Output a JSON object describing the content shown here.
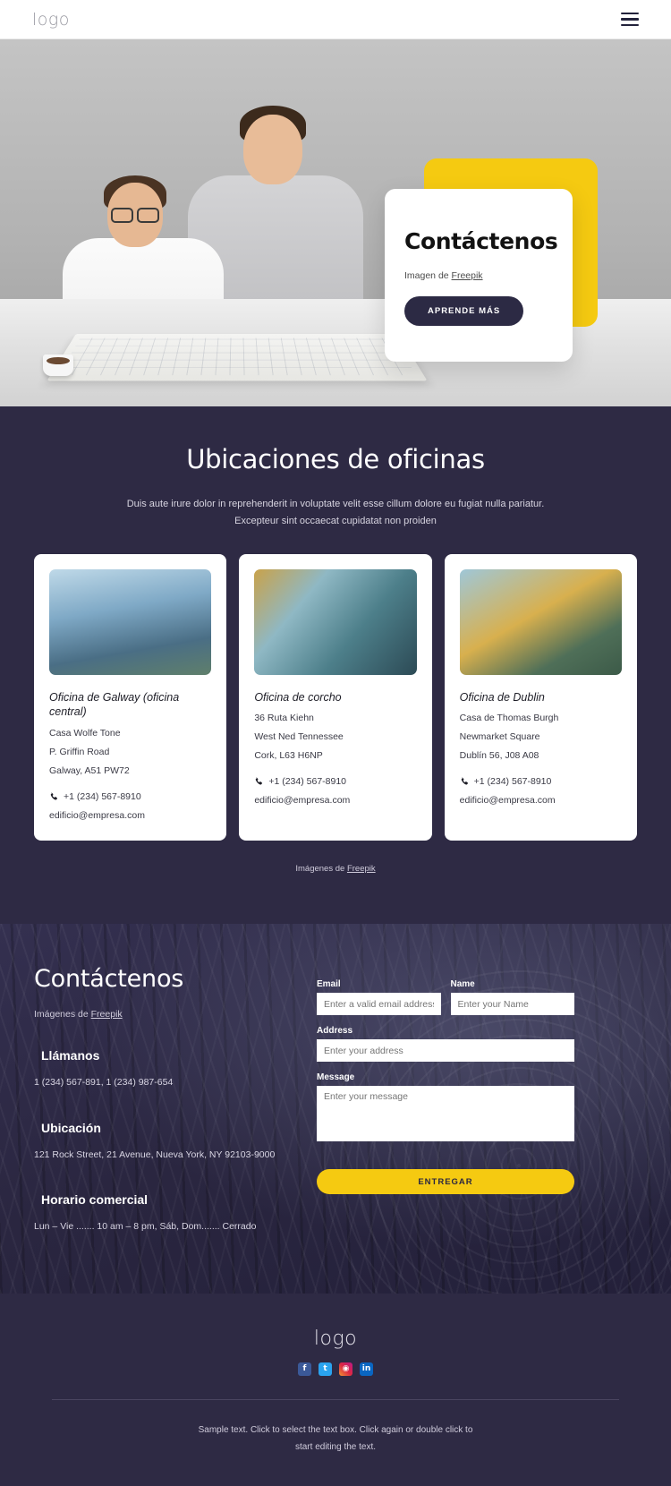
{
  "header": {
    "logo": "logo",
    "menu_icon": "hamburger-menu-icon"
  },
  "hero": {
    "title": "Contáctenos",
    "credit_prefix": "Imagen de ",
    "credit_link": "Freepik",
    "cta": "APRENDE MÁS"
  },
  "offices": {
    "title": "Ubicaciones de oficinas",
    "subtitle_line1": "Duis aute irure dolor in reprehenderit in voluptate velit esse cillum dolore eu fugiat nulla pariatur.",
    "subtitle_line2": "Excepteur sint occaecat cupidatat non proiden",
    "credit_prefix": "Imágenes de ",
    "credit_link": "Freepik",
    "cards": [
      {
        "title": "Oficina de Galway (oficina central)",
        "line1": "Casa Wolfe Tone",
        "line2": "P. Griffin Road",
        "line3": "Galway, A51 PW72",
        "phone": "+1 (234) 567-8910",
        "email": "edificio@empresa.com"
      },
      {
        "title": "Oficina de corcho",
        "line1": "36 Ruta Kiehn",
        "line2": "West Ned Tennessee",
        "line3": "Cork, L63 H6NP",
        "phone": "+1 (234) 567-8910",
        "email": "edificio@empresa.com"
      },
      {
        "title": "Oficina de Dublin",
        "line1": "Casa de Thomas Burgh",
        "line2": "Newmarket Square",
        "line3": "Dublín 56, J08 A08",
        "phone": "+1 (234) 567-8910",
        "email": "edificio@empresa.com"
      }
    ]
  },
  "contact": {
    "title": "Contáctenos",
    "credit_prefix": "Imágenes de ",
    "credit_link": "Freepik",
    "call_heading": "Llámanos",
    "call_text": "1 (234) 567-891, 1 (234) 987-654",
    "location_heading": "Ubicación",
    "location_text": "121 Rock Street, 21 Avenue, Nueva York, NY 92103-9000",
    "hours_heading": "Horario comercial",
    "hours_text": "Lun – Vie ....... 10 am – 8 pm, Sáb, Dom....... Cerrado",
    "form": {
      "email_label": "Email",
      "email_placeholder": "Enter a valid email address",
      "email_value": "",
      "name_label": "Name",
      "name_placeholder": "Enter your Name",
      "name_value": "",
      "address_label": "Address",
      "address_placeholder": "Enter your address",
      "address_value": "",
      "message_label": "Message",
      "message_placeholder": "Enter your message",
      "message_value": "",
      "submit": "ENTREGAR"
    }
  },
  "footer": {
    "logo": "logo",
    "socials": [
      {
        "name": "facebook",
        "glyph": "f"
      },
      {
        "name": "twitter",
        "glyph": "t"
      },
      {
        "name": "instagram",
        "glyph": "◉"
      },
      {
        "name": "linkedin",
        "glyph": "in"
      }
    ],
    "note_line1": "Sample text. Click to select the text box. Click again or double click to",
    "note_line2": "start editing the text."
  },
  "colors": {
    "dark": "#2e2a44",
    "yellow": "#f5ca11",
    "white": "#ffffff"
  }
}
